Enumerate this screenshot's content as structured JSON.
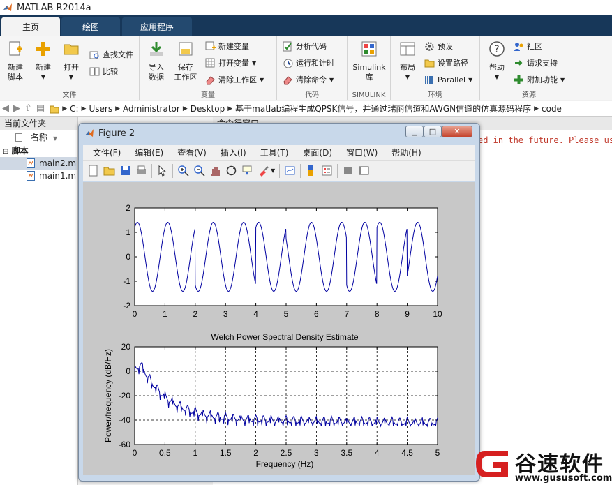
{
  "app": {
    "title": "MATLAB R2014a"
  },
  "tabs": [
    {
      "label": "主页"
    },
    {
      "label": "绘图"
    },
    {
      "label": "应用程序"
    }
  ],
  "ribbon": {
    "file_group": {
      "label": "文件",
      "new_script": "新建\n脚本",
      "new": "新建",
      "open": "打开",
      "find_files": "查找文件",
      "compare": "比较"
    },
    "variable_group": {
      "label": "变量",
      "import": "导入\n数据",
      "save_workspace": "保存\n工作区",
      "new_variable": "新建变量",
      "open_variable": "打开变量",
      "clear_workspace": "清除工作区"
    },
    "code_group": {
      "label": "代码",
      "analyze": "分析代码",
      "run_time": "运行和计时",
      "clear_commands": "清除命令"
    },
    "simulink_group": {
      "label": "SIMULINK",
      "library": "Simulink\n库"
    },
    "env_group": {
      "label": "环境",
      "layout": "布局",
      "preferences": "预设",
      "set_path": "设置路径",
      "parallel": "Parallel"
    },
    "resources_group": {
      "label": "资源",
      "help": "帮助",
      "community": "社区",
      "request_support": "请求支持",
      "addons": "附加功能"
    }
  },
  "address": {
    "segments": [
      "C:",
      "Users",
      "Administrator",
      "Desktop",
      "基于matlab编程生成QPSK信号，并通过瑞丽信道和AWGN信道的仿真源码程序",
      "code"
    ]
  },
  "left_pane": {
    "title": "当前文件夹",
    "column": "名称",
    "folder": "脚本",
    "files": [
      "main2.m",
      "main1.m"
    ]
  },
  "command_window": {
    "title": "命令行窗口",
    "text": "ed in the future. Please us"
  },
  "figure": {
    "title": "Figure 2",
    "menu": [
      "文件(F)",
      "编辑(E)",
      "查看(V)",
      "插入(I)",
      "工具(T)",
      "桌面(D)",
      "窗口(W)",
      "帮助(H)"
    ],
    "win_buttons": {
      "min": "▭",
      "max": "□",
      "close": "✕"
    }
  },
  "colors": {
    "plot_line": "#0000a0",
    "tab_bg": "#173759"
  },
  "chart_data": [
    {
      "type": "line",
      "title": "",
      "xlabel": "",
      "ylabel": "",
      "xlim": [
        0,
        10
      ],
      "ylim": [
        -2,
        2
      ],
      "xticks": [
        "0",
        "1",
        "2",
        "3",
        "4",
        "5",
        "6",
        "7",
        "8",
        "9",
        "10"
      ],
      "yticks": [
        "2",
        "1",
        "0",
        "-1",
        "-2"
      ],
      "grid": false,
      "series": [
        {
          "signal": "QPSK carrier waveform, amplitude ≈ 1.4, ~10 cycles over 0–10 with phase jumps"
        }
      ]
    },
    {
      "type": "line",
      "title": "Welch Power Spectral Density Estimate",
      "xlabel": "Frequency (Hz)",
      "ylabel": "Power/frequency (dB/Hz)",
      "xlim": [
        0,
        5
      ],
      "ylim": [
        -60,
        20
      ],
      "xticks": [
        "0",
        "0.5",
        "1",
        "1.5",
        "2",
        "2.5",
        "3",
        "3.5",
        "4",
        "4.5",
        "5"
      ],
      "yticks": [
        "20",
        "0",
        "-20",
        "-40",
        "-60"
      ],
      "grid": true,
      "series": [
        {
          "peak_db": 10,
          "peak_hz": 0.1,
          "floor_db": -35,
          "end_db": -38
        }
      ]
    }
  ],
  "watermark": {
    "text": "谷速软件",
    "url": "www.gususoft.com"
  }
}
